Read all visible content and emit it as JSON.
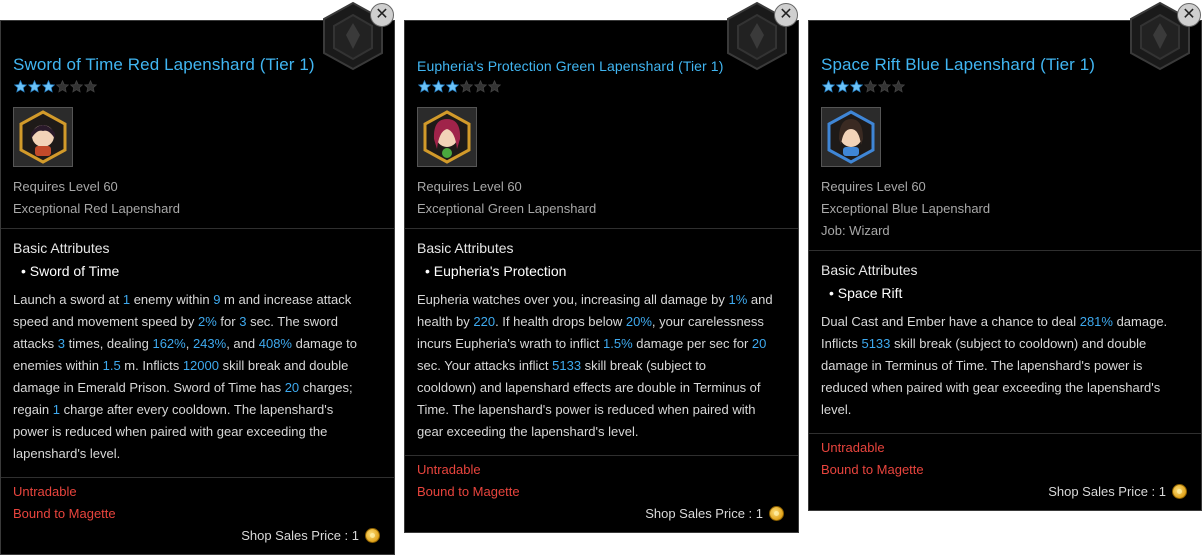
{
  "cards": [
    {
      "title": "Sword of Time Red Lapenshard (Tier 1)",
      "stars": {
        "filled": 3,
        "total": 6
      },
      "portrait_color": "#c24a2a",
      "requires": "Requires Level 60",
      "grade": "Exceptional Red Lapenshard",
      "job": "",
      "section": "Basic Attributes",
      "skill": "• Sword of Time",
      "desc": [
        [
          "Launch a sword at ",
          "1",
          " enemy within ",
          "9",
          " m and increase attack"
        ],
        [
          "speed and movement speed by ",
          "2%",
          " for ",
          "3",
          " sec. The sword"
        ],
        [
          "attacks ",
          "3",
          " times, dealing ",
          "162%",
          ", ",
          "243%",
          ", and ",
          "408%",
          " damage to"
        ],
        [
          "enemies within ",
          "1.5",
          " m. Inflicts ",
          "12000",
          " skill break and double"
        ],
        [
          "damage in Emerald Prison. Sword of Time has ",
          "20",
          " charges;"
        ],
        [
          "regain ",
          "1",
          " charge after every cooldown. The lapenshard's"
        ],
        [
          "power is reduced when paired with gear exceeding the"
        ],
        [
          "lapenshard's level."
        ]
      ],
      "untradable": "Untradable",
      "bound": "Bound to Magette",
      "price": "Shop Sales Price : 1"
    },
    {
      "title": "Eupheria's Protection Green Lapenshard (Tier 1)",
      "stars": {
        "filled": 3,
        "total": 6
      },
      "portrait_color": "#4aa83e",
      "requires": "Requires Level 60",
      "grade": "Exceptional Green Lapenshard",
      "job": "",
      "section": "Basic Attributes",
      "skill": "• Eupheria's Protection",
      "desc": [
        [
          "Eupheria watches over you, increasing all damage by ",
          "1%",
          " and"
        ],
        [
          "health by ",
          "220",
          ". If health drops below ",
          "20%",
          ", your carelessness"
        ],
        [
          "incurs Eupheria's wrath to inflict ",
          "1.5%",
          " damage per sec for ",
          "20"
        ],
        [
          "sec. Your attacks inflict ",
          "5133",
          " skill break (subject to"
        ],
        [
          "cooldown) and lapenshard effects are double in Terminus of"
        ],
        [
          "Time. The lapenshard's power is reduced when paired with"
        ],
        [
          "gear exceeding the lapenshard's level."
        ]
      ],
      "untradable": "Untradable",
      "bound": "Bound to Magette",
      "price": "Shop Sales Price : 1"
    },
    {
      "title": "Space Rift Blue Lapenshard (Tier 1)",
      "stars": {
        "filled": 3,
        "total": 6
      },
      "portrait_color": "#3f86d6",
      "requires": "Requires Level 60",
      "grade": "Exceptional Blue Lapenshard",
      "job": "Job: Wizard",
      "section": "Basic Attributes",
      "skill": "• Space Rift",
      "desc": [
        [
          "Dual Cast and Ember have a chance to deal ",
          "281%",
          " damage."
        ],
        [
          "Inflicts ",
          "5133",
          " skill break (subject to cooldown) and double"
        ],
        [
          "damage in Terminus of Time. The lapenshard's power is"
        ],
        [
          "reduced when paired with gear exceeding the lapenshard's"
        ],
        [
          "level."
        ]
      ],
      "untradable": "Untradable",
      "bound": "Bound to Magette",
      "price": "Shop Sales Price : 1"
    }
  ]
}
